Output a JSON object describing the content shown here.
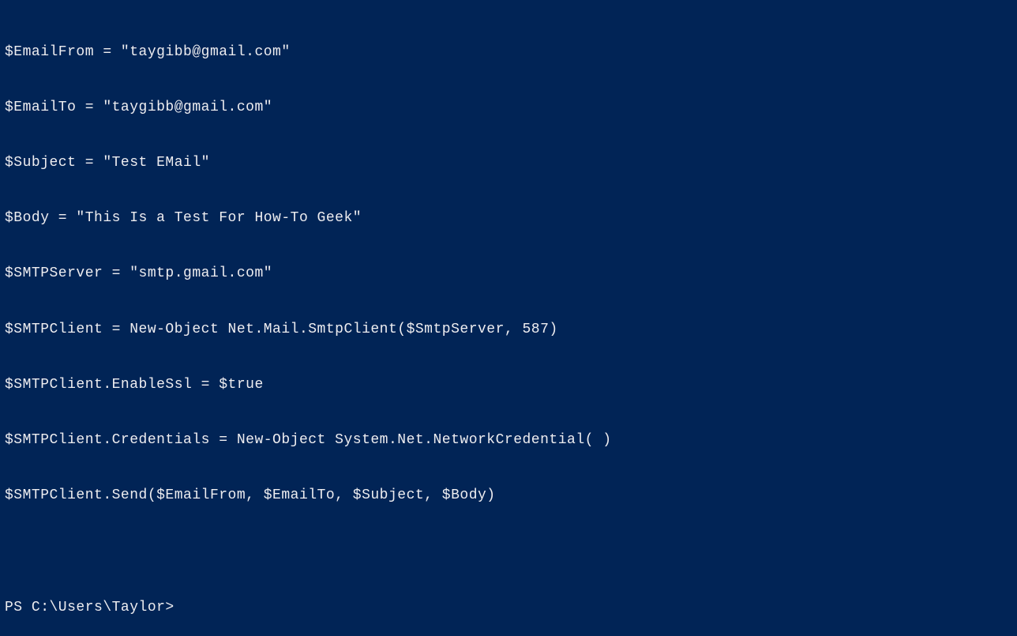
{
  "terminal": {
    "lines": [
      "$EmailFrom = \"taygibb@gmail.com\"",
      "$EmailTo = \"taygibb@gmail.com\"",
      "$Subject = \"Test EMail\"",
      "$Body = \"This Is a Test For How-To Geek\"",
      "$SMTPServer = \"smtp.gmail.com\"",
      "$SMTPClient = New-Object Net.Mail.SmtpClient($SmtpServer, 587)",
      "$SMTPClient.EnableSsl = $true",
      "$SMTPClient.Credentials = New-Object System.Net.NetworkCredential( )",
      "$SMTPClient.Send($EmailFrom, $EmailTo, $Subject, $Body)"
    ],
    "prompt": "PS C:\\Users\\Taylor>"
  }
}
